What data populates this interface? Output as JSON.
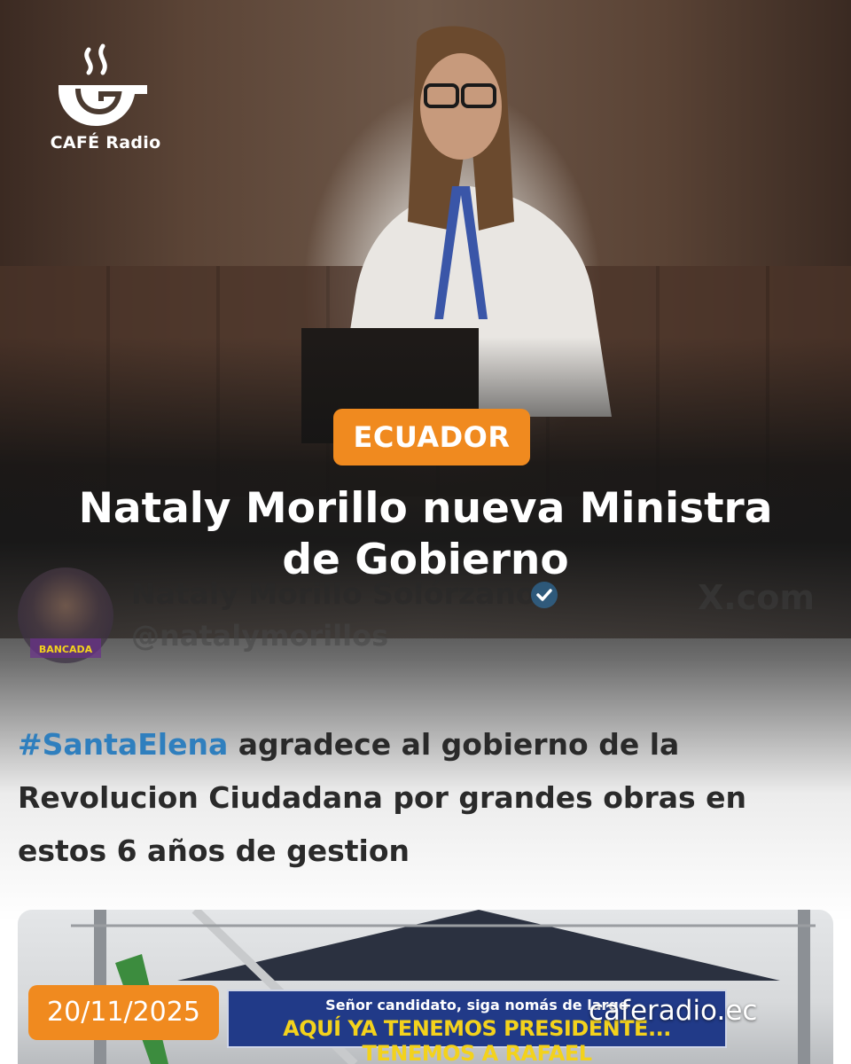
{
  "brand": {
    "name": "CAFÉ Radio",
    "website": "caferadio.ec"
  },
  "category_tag": "ECUADOR",
  "headline": {
    "line1": "Nataly Morillo nueva Ministra",
    "line2": "de Gobierno"
  },
  "tweet": {
    "display_name": "Nataly Morillo Solórzano",
    "handle": "@natalymorillos",
    "source": "X.com",
    "hashtag": "#SantaElena",
    "text_after_hashtag": " agradece al gobierno de la Revolucion Ciudadana por grandes obras en estos 6 años de gestion",
    "avatar_label": "BANCADA"
  },
  "embedded_photo": {
    "banner_top": "Señor candidato, siga nomás de largo",
    "banner_main": "AQUÍ YA TENEMOS PRESIDENTE... TENEMOS A RAFAEL"
  },
  "date": "20/11/2025",
  "colors": {
    "accent": "#f08a1f",
    "hashtag": "#2f7fbe",
    "banner_blue": "#213a88",
    "banner_yellow": "#f3d21c"
  },
  "icons": {
    "logo": "coffee-cup-logo-icon",
    "verified": "verified-badge-icon"
  }
}
